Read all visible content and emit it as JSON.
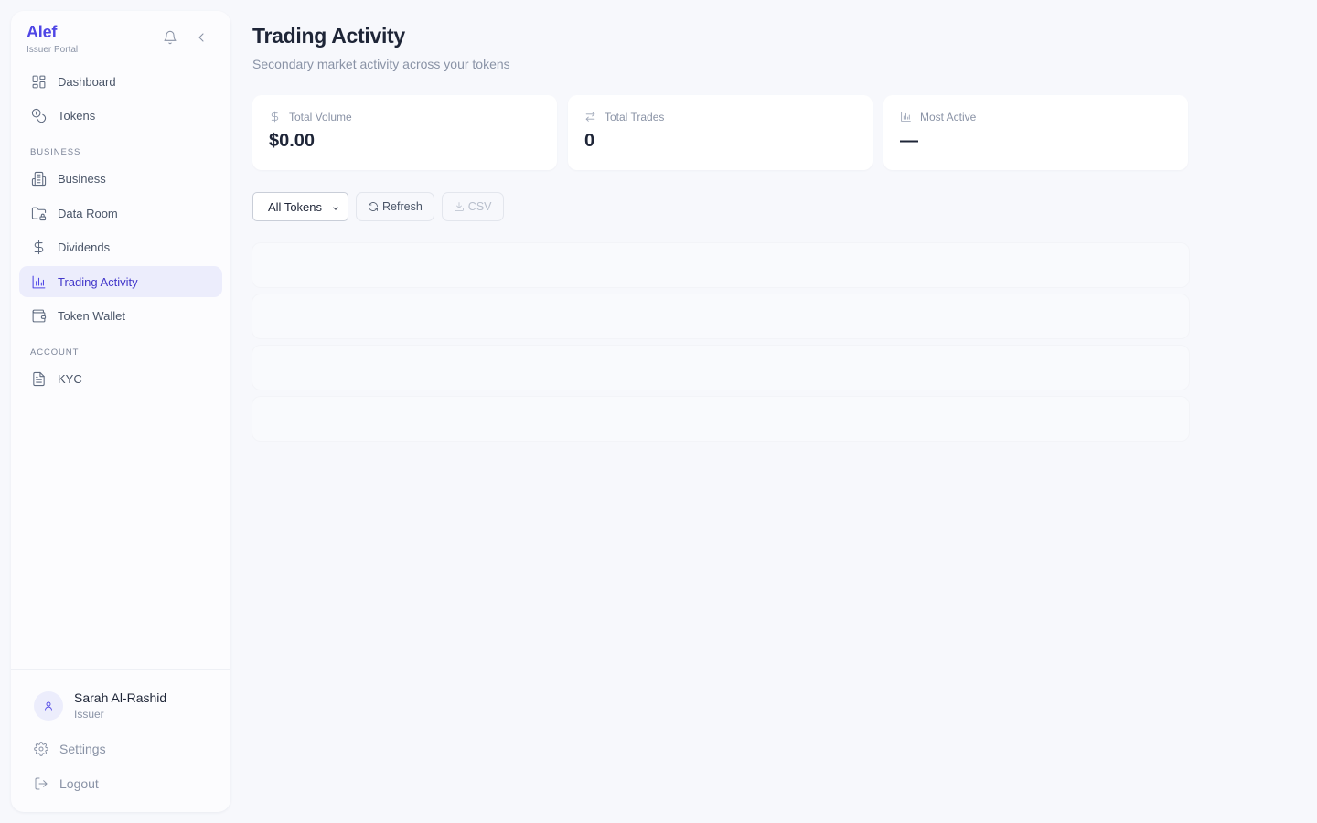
{
  "brand": {
    "name": "Alef",
    "subtitle": "Issuer Portal"
  },
  "header_icons": [
    "bell-icon",
    "chevron-left-icon"
  ],
  "nav": {
    "top": [
      {
        "label": "Dashboard",
        "icon": "grid-icon"
      },
      {
        "label": "Tokens",
        "icon": "coins-icon"
      }
    ],
    "business_label": "BUSINESS",
    "business": [
      {
        "label": "Business",
        "icon": "building-icon"
      },
      {
        "label": "Data Room",
        "icon": "folder-lock-icon"
      },
      {
        "label": "Dividends",
        "icon": "dollar-icon"
      },
      {
        "label": "Trading Activity",
        "icon": "bar-chart-icon",
        "active": true
      },
      {
        "label": "Token Wallet",
        "icon": "wallet-icon"
      }
    ],
    "account_label": "ACCOUNT",
    "account": [
      {
        "label": "KYC",
        "icon": "file-text-icon"
      }
    ]
  },
  "user": {
    "name": "Sarah Al-Rashid",
    "role": "Issuer"
  },
  "footer": {
    "settings_label": "Settings",
    "logout_label": "Logout"
  },
  "page": {
    "title": "Trading Activity",
    "subtitle": "Secondary market activity across your tokens"
  },
  "stats": [
    {
      "label": "Total Volume",
      "value": "$0.00",
      "icon": "dollar-icon"
    },
    {
      "label": "Total Trades",
      "value": "0",
      "icon": "arrows-swap-icon"
    },
    {
      "label": "Most Active",
      "value": "—",
      "icon": "bar-chart-icon"
    }
  ],
  "toolbar": {
    "token_filter": "All Tokens",
    "refresh_label": "Refresh",
    "csv_label": "CSV"
  },
  "accent_color": "#4f46e5"
}
